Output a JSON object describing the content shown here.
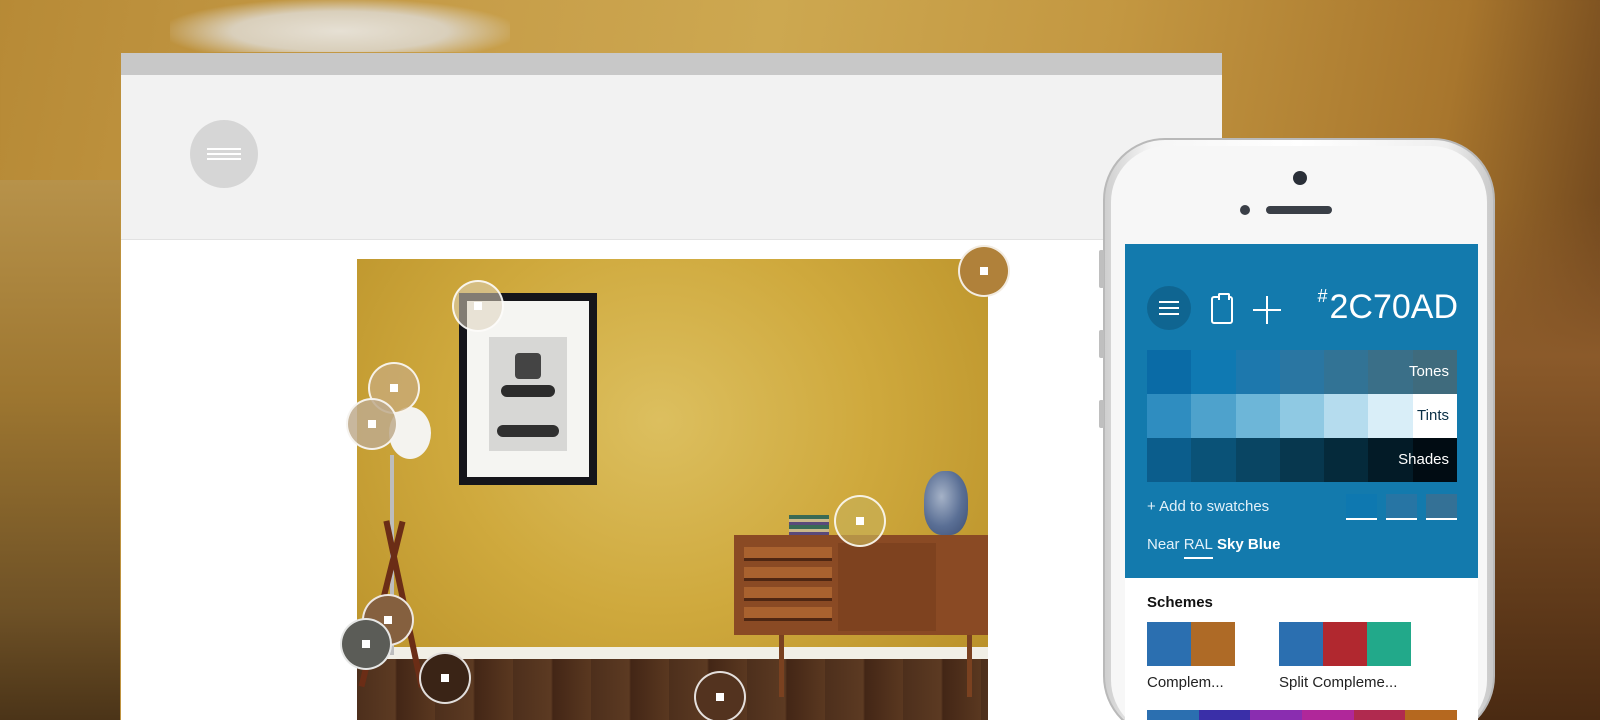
{
  "colors": {
    "app_blue": "#137aad",
    "selected_color": "#2C70AD"
  },
  "browser": {
    "menu_icon": "hamburger-menu-icon"
  },
  "app": {
    "menu_icon": "hamburger-menu-icon",
    "clipboard_icon": "clipboard-icon",
    "add_icon": "plus-icon",
    "hex_prefix": "#",
    "hex_value": "2C70AD",
    "palette": {
      "tones": [
        "#0a6ba6",
        "#0f79b2",
        "#1d78ad",
        "#2a76a2",
        "#327395",
        "#3a6f88",
        "#3f6b7d"
      ],
      "tints": [
        "#2f8dc0",
        "#4ea2cc",
        "#6db6d8",
        "#8fc9e3",
        "#b5dcee",
        "#d9eef8",
        "#ffffff"
      ],
      "shades": [
        "#0b5d8c",
        "#0a5277",
        "#094563",
        "#07374e",
        "#052a3b",
        "#031b27",
        "#010c13"
      ],
      "labels": {
        "tones": "Tones",
        "tints": "Tints",
        "shades": "Shades"
      }
    },
    "add_to_swatches": "+ Add to swatches",
    "recent_swatches": [
      "#0e78b0",
      "#2775a4",
      "#347196"
    ],
    "near_prefix": "Near",
    "near_ral": "RAL",
    "near_name": "Sky Blue",
    "schemes_title": "Schemes",
    "schemes": [
      {
        "label": "Complem...",
        "colors": [
          "#2b6fb0",
          "#ae6a26"
        ]
      },
      {
        "label": "Split Compleme...",
        "colors": [
          "#2b6fb0",
          "#b1282f",
          "#22a98a"
        ]
      }
    ],
    "partial_scheme_colors": [
      "#2b6fb0",
      "#3a2fa8",
      "#8a2db0",
      "#b0279a",
      "#b02a4f",
      "#b5681f"
    ]
  },
  "samples": [
    "wall-sample",
    "frame-sample",
    "lamp-sample-1",
    "lamp-sample-2",
    "books-sample",
    "tripod-sample-1",
    "tripod-sample-2",
    "floor-sample-1",
    "floor-sample-2"
  ]
}
